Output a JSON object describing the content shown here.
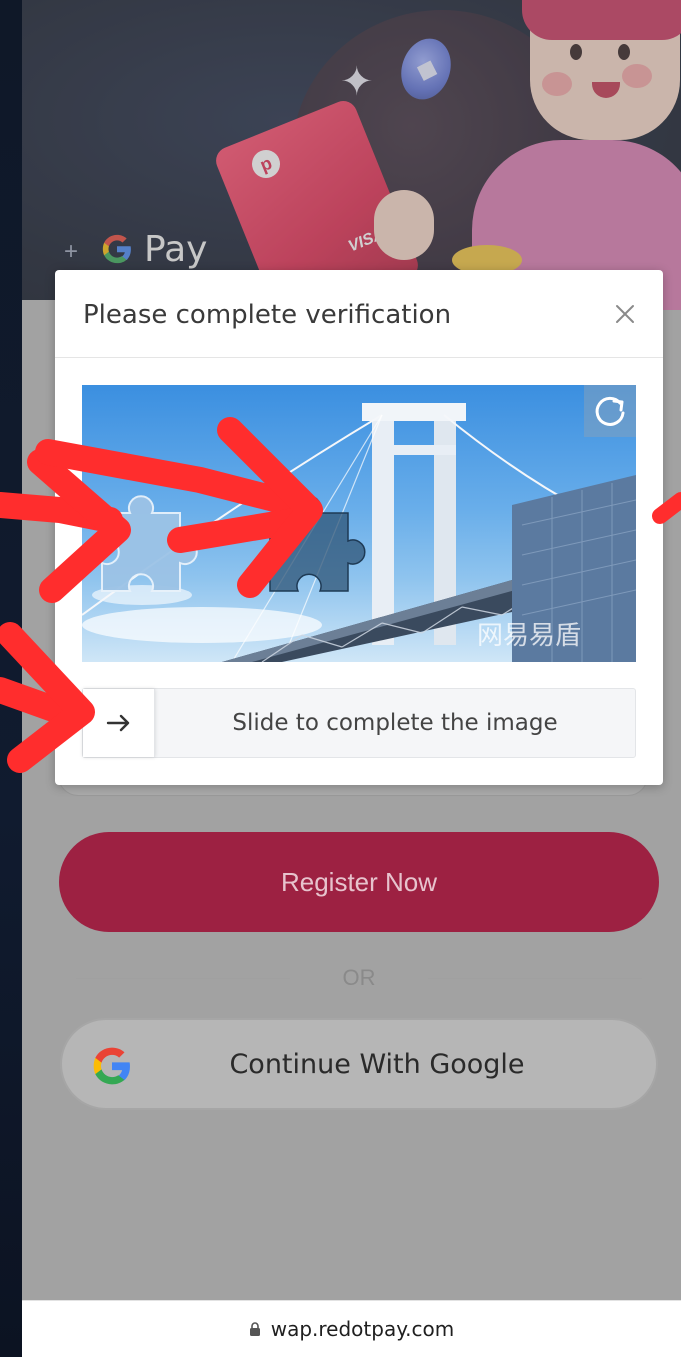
{
  "hero": {
    "brand_text": "Pay",
    "card_brand": "VISA",
    "card_logo_letter": "p"
  },
  "modal": {
    "title": "Please complete verification",
    "watermark": "网易易盾",
    "slider_label": "Slide to complete the image"
  },
  "form": {
    "register_label": "Register Now",
    "divider_text": "OR",
    "google_label": "Continue With Google"
  },
  "browser": {
    "url": "wap.redotpay.com"
  },
  "colors": {
    "register": "#9d2142",
    "annotation_arrow": "#ff2d2d",
    "google_blue": "#4285F4",
    "google_red": "#EA4335",
    "google_yellow": "#FBBC05",
    "google_green": "#34A853"
  },
  "icons": {
    "close": "close-icon",
    "refresh": "refresh-icon",
    "slider": "arrow-right-icon",
    "lock": "lock-icon",
    "google": "google-g-icon"
  }
}
